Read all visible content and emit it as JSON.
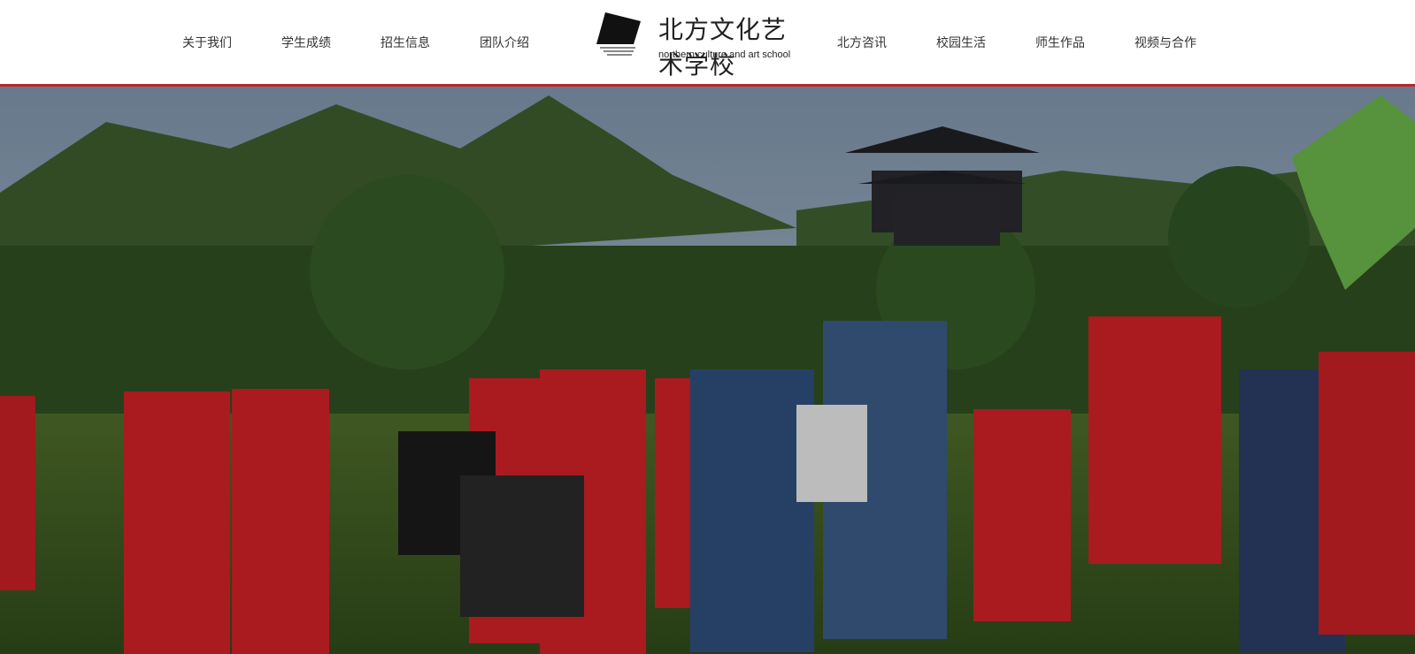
{
  "nav_left": [
    "关于我们",
    "学生成绩",
    "招生信息",
    "团队介绍"
  ],
  "nav_right": [
    "北方咨讯",
    "校园生活",
    "师生作品",
    "视频与合作"
  ],
  "logo": {
    "cn": "北方文化艺术学校",
    "en": "northern culture and art school"
  },
  "colors": {
    "accent": "#b8272d",
    "text": "#333333",
    "sky": "#9fb2c6",
    "shirt": "#d9232a"
  },
  "hero": {
    "alt": "students in red shirts walking in a park"
  }
}
